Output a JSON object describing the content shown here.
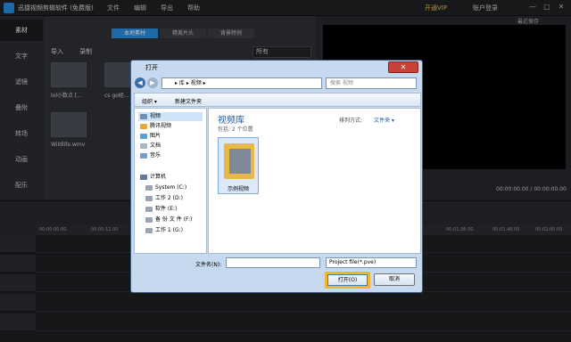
{
  "app": {
    "title": "迅捷视频剪辑软件 (免费版)",
    "menu": [
      "文件",
      "编辑",
      "导出",
      "帮助"
    ],
    "vip": "开通VIP",
    "login": "账户登录",
    "preview_label": "最近保存",
    "timecode": "00:00:00.00 / 00:00:00.00"
  },
  "nav": [
    "素材",
    "文字",
    "滤镜",
    "叠附",
    "转场",
    "动画",
    "配乐"
  ],
  "media": {
    "tabs": [
      "本地素材",
      "精美片头",
      "背景特例"
    ],
    "import": "导入",
    "record": "录制",
    "filter": "所有",
    "thumbs": [
      {
        "label": "lol小数点 [..."
      },
      {
        "label": "cs go经..."
      },
      {
        "label": "Wildlife.wmv"
      }
    ]
  },
  "timeline": {
    "ruler": [
      "00:00:00.00",
      "00:00:12.00",
      "00:01:36.00",
      "00:01:48.00",
      "00:02:00.00"
    ]
  },
  "dialog": {
    "title": "打开",
    "close": "✕",
    "breadcrumb": "▸ 库 ▸ 视频 ▸",
    "search_placeholder": "搜索 视频",
    "cmd_organize": "组织 ▾",
    "cmd_newfolder": "新建文件夹",
    "nav_items": [
      "视频",
      "腾讯视频",
      "图片",
      "文档",
      "音乐",
      "计算机",
      "System (C:)",
      "工作 2 (D:)",
      "软件 (E:)",
      "备 份 文 件 (F:)",
      "工作 1 (G:)"
    ],
    "library_title": "视频库",
    "library_sub": "包括: 2 个位置",
    "sort_label": "排列方式:",
    "sort_value": "文件夹 ▾",
    "folder_label": "示例视频",
    "filename_label": "文件名(N):",
    "filetype": "Project file(*.pve)",
    "open_button": "打开(O)",
    "cancel_button": "取消"
  }
}
